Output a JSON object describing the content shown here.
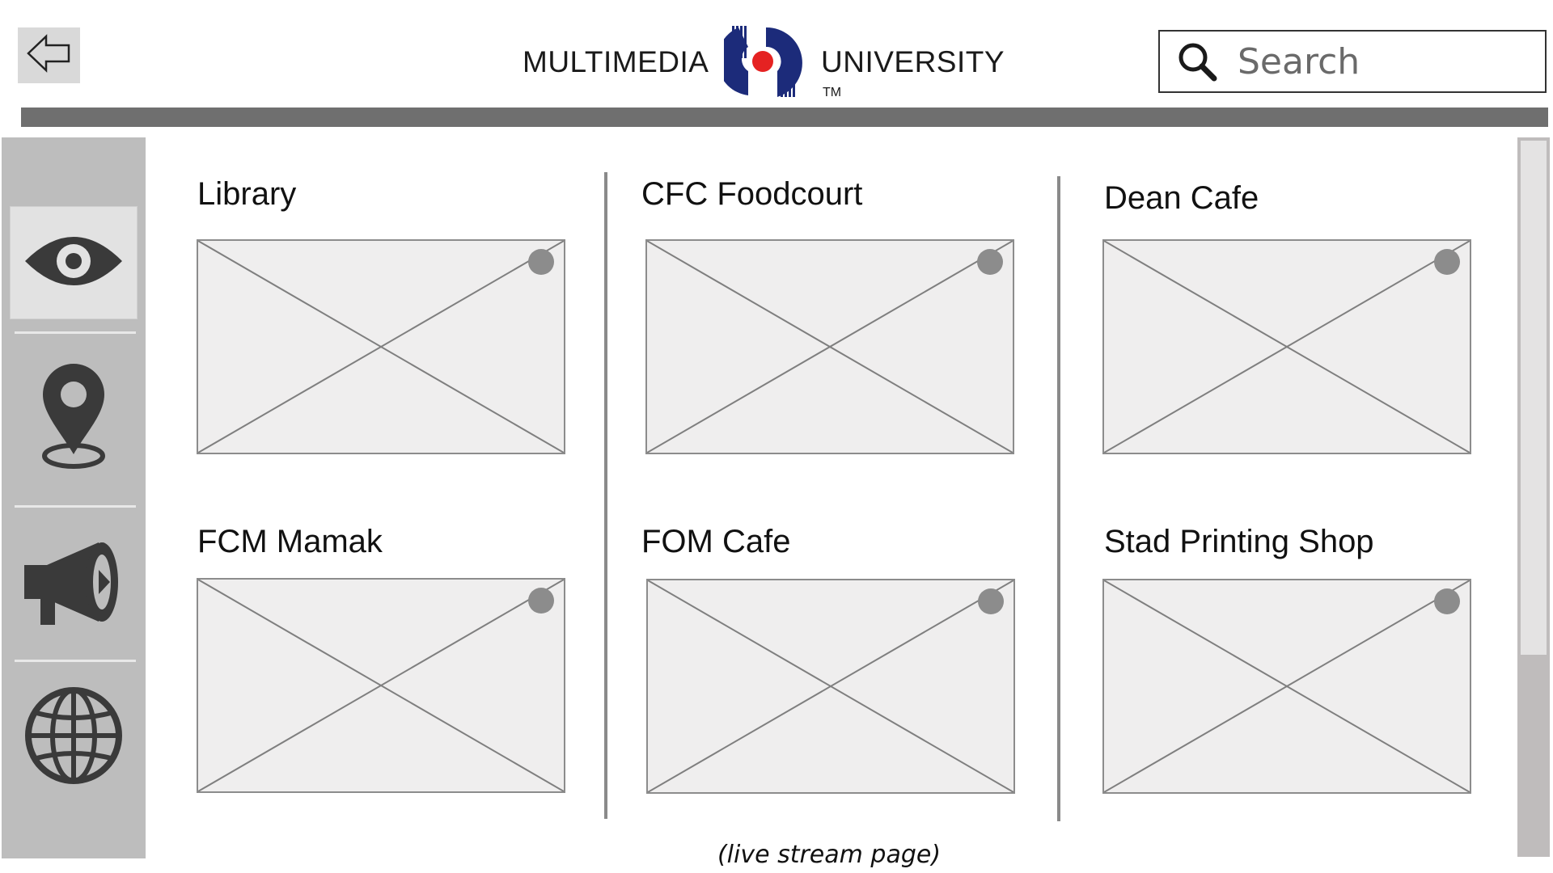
{
  "header": {
    "logo_left": "MULTIMEDIA",
    "logo_right": "UNIVERSITY",
    "logo_tm": "TM",
    "search_placeholder": "Search",
    "logo_colors": {
      "navy": "#1c2b7a",
      "red": "#e52222"
    }
  },
  "sidebar": {
    "items": [
      {
        "icon": "eye-icon",
        "active": true
      },
      {
        "icon": "location-pin-icon",
        "active": false
      },
      {
        "icon": "megaphone-icon",
        "active": false
      },
      {
        "icon": "globe-icon",
        "active": false
      }
    ]
  },
  "cards": [
    {
      "title": "Library"
    },
    {
      "title": "CFC Foodcourt"
    },
    {
      "title": "Dean Cafe"
    },
    {
      "title": "FCM Mamak"
    },
    {
      "title": "FOM Cafe"
    },
    {
      "title": "Stad Printing Shop"
    }
  ],
  "caption": "(live stream page)"
}
